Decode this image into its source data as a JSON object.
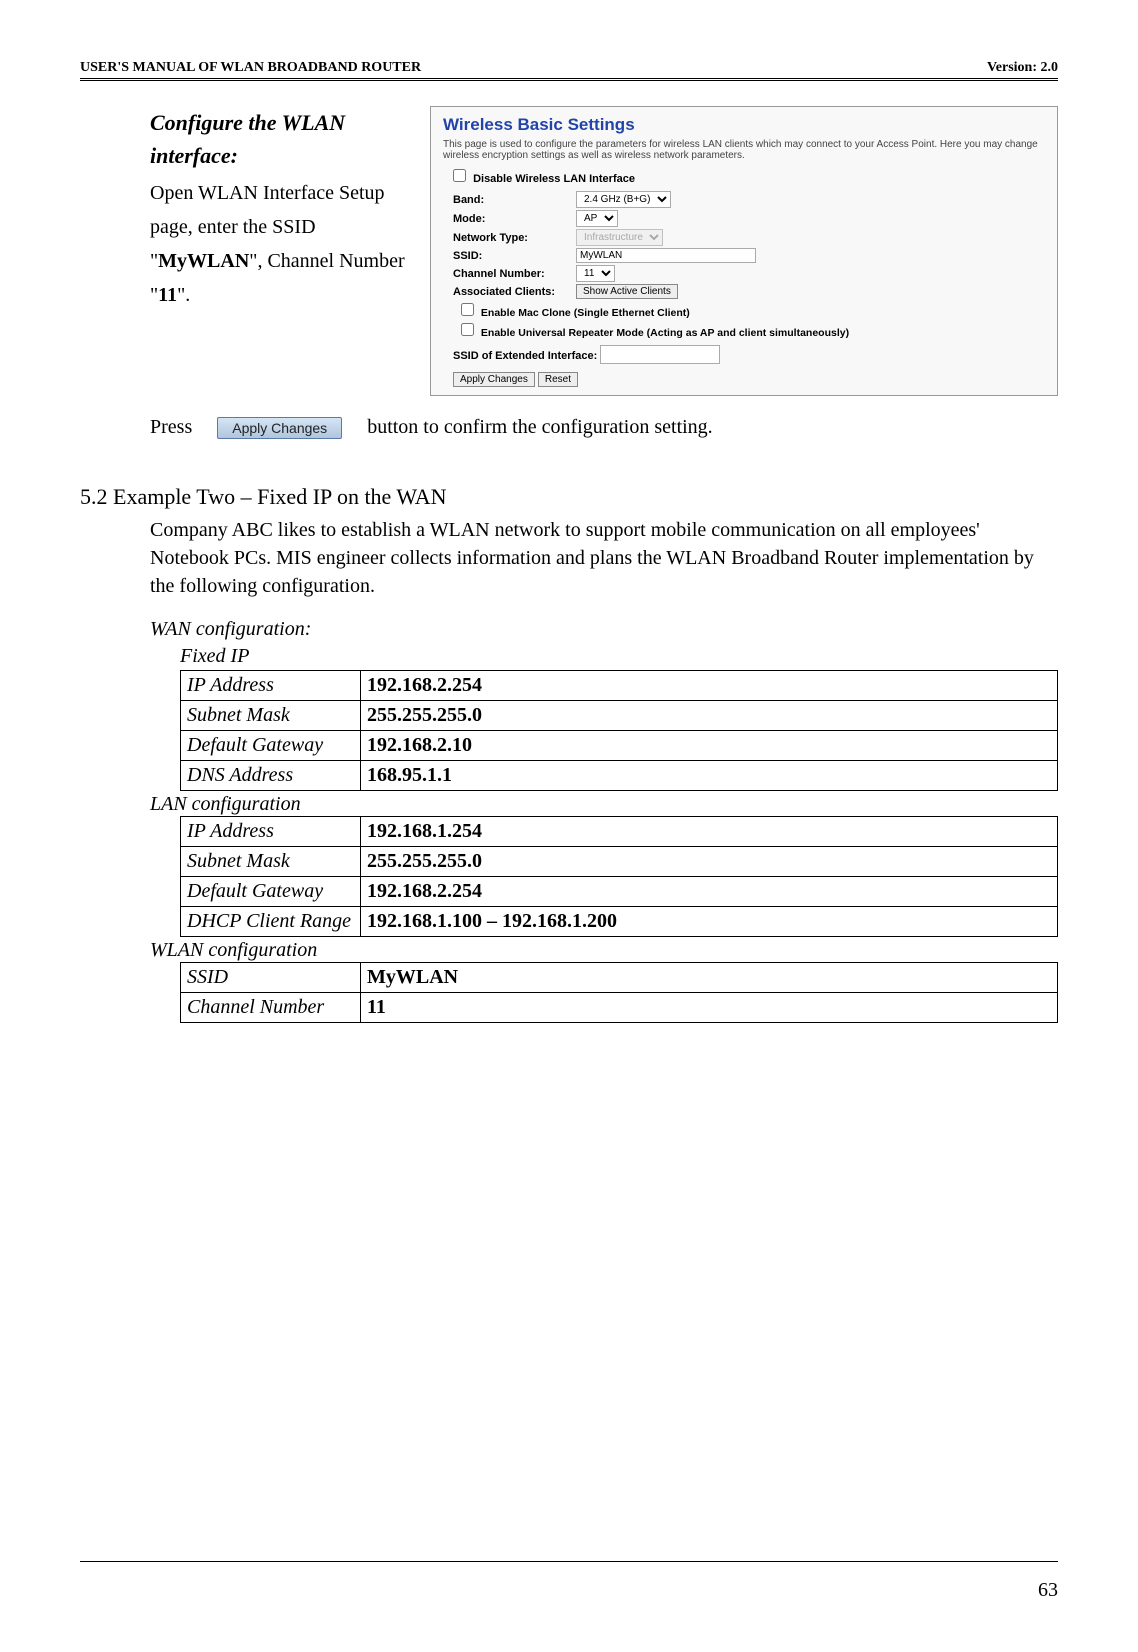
{
  "header": {
    "title": "USER'S MANUAL OF WLAN BROADBAND ROUTER",
    "version": "Version: 2.0"
  },
  "configure": {
    "title": "Configure the WLAN interface:",
    "body_prefix": "Open WLAN Interface Setup page, enter the SSID \"",
    "ssid": "MyWLAN",
    "body_mid": "\", Channel Number \"",
    "channel": "11",
    "body_suffix": "\"."
  },
  "panel": {
    "title": "Wireless Basic Settings",
    "desc": "This page is used to configure the parameters for wireless LAN clients which may connect to your Access Point. Here you may change wireless encryption settings as well as wireless network parameters.",
    "disable": "Disable Wireless LAN Interface",
    "band_label": "Band:",
    "band_value": "2.4 GHz (B+G)",
    "mode_label": "Mode:",
    "mode_value": "AP",
    "network_type_label": "Network Type:",
    "network_type_value": "Infrastructure",
    "ssid_label": "SSID:",
    "ssid_value": "MyWLAN",
    "channel_label": "Channel Number:",
    "channel_value": "11",
    "assoc_label": "Associated Clients:",
    "show_btn": "Show Active Clients",
    "mac_clone": "Enable Mac Clone (Single Ethernet Client)",
    "repeater": "Enable Universal Repeater Mode (Acting as AP and client simultaneously)",
    "ssid_ext_label": "SSID of Extended Interface:",
    "apply_btn": "Apply Changes",
    "reset_btn": "Reset"
  },
  "press": {
    "press_text": "Press",
    "apply_btn": "Apply Changes",
    "after_text": "button to confirm the configuration setting."
  },
  "section52": {
    "heading": "5.2 Example Two – Fixed IP on the WAN",
    "body": "Company ABC likes to establish a WLAN network to support mobile communication on all employees' Notebook PCs. MIS engineer collects information and plans the WLAN Broadband Router implementation by the following configuration."
  },
  "wan": {
    "label": "WAN configuration:",
    "fixed_ip": "Fixed IP",
    "rows": [
      {
        "k": "IP Address",
        "v": "192.168.2.254"
      },
      {
        "k": "Subnet Mask",
        "v": "255.255.255.0"
      },
      {
        "k": "Default Gateway",
        "v": "192.168.2.10"
      },
      {
        "k": "DNS Address",
        "v": "168.95.1.1"
      }
    ]
  },
  "lan": {
    "label": "LAN configuration",
    "rows": [
      {
        "k": "IP Address",
        "v": "192.168.1.254"
      },
      {
        "k": "Subnet Mask",
        "v": "255.255.255.0"
      },
      {
        "k": "Default Gateway",
        "v": "192.168.2.254"
      },
      {
        "k": "DHCP Client Range",
        "v": "192.168.1.100 – 192.168.1.200"
      }
    ]
  },
  "wlan": {
    "label": "WLAN configuration",
    "rows": [
      {
        "k": "SSID",
        "v": "MyWLAN"
      },
      {
        "k": "Channel Number",
        "v": "11"
      }
    ]
  },
  "page_number": "63"
}
